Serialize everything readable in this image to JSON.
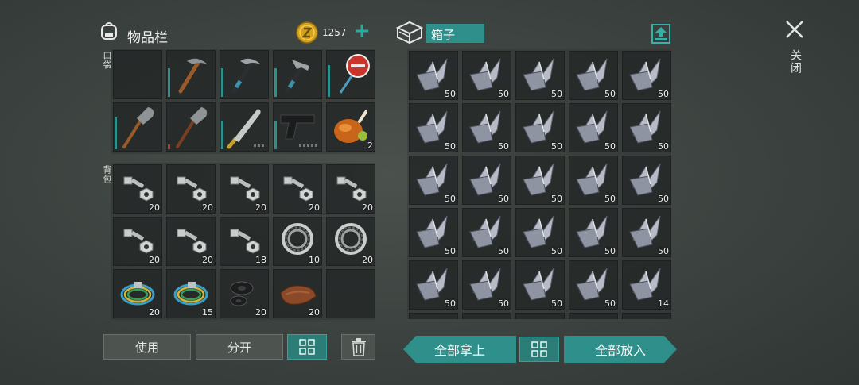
{
  "inventory": {
    "title": "物品栏",
    "coins": "1257",
    "add_label": "+",
    "pocket_label": "口袋",
    "backpack_label": "背包",
    "pocket_slots": [
      {
        "item": "empty",
        "qty": ""
      },
      {
        "item": "pickaxe-icon",
        "qty": ""
      },
      {
        "item": "pickaxe-icon",
        "qty": ""
      },
      {
        "item": "hammer-icon",
        "qty": ""
      },
      {
        "item": "stop-sign-icon",
        "qty": ""
      },
      {
        "item": "shovel-icon",
        "qty": ""
      },
      {
        "item": "shovel-icon",
        "qty": ""
      },
      {
        "item": "machete-icon",
        "qty": ""
      },
      {
        "item": "pistol-icon",
        "qty": ""
      },
      {
        "item": "roast-chicken-icon",
        "qty": "2"
      }
    ],
    "backpack_slots": [
      {
        "item": "bolt-nut-icon",
        "qty": "20"
      },
      {
        "item": "bolt-nut-icon",
        "qty": "20"
      },
      {
        "item": "bolt-nut-icon",
        "qty": "20"
      },
      {
        "item": "bolt-nut-icon",
        "qty": "20"
      },
      {
        "item": "bolt-nut-icon",
        "qty": "20"
      },
      {
        "item": "bolt-nut-icon",
        "qty": "20"
      },
      {
        "item": "bolt-nut-icon",
        "qty": "20"
      },
      {
        "item": "bolt-nut-icon",
        "qty": "18"
      },
      {
        "item": "bearing-icon",
        "qty": "10"
      },
      {
        "item": "bearing-icon",
        "qty": "20"
      },
      {
        "item": "wire-coil-icon",
        "qty": "20"
      },
      {
        "item": "wire-coil-icon",
        "qty": "15"
      },
      {
        "item": "rubber-washer-icon",
        "qty": "20"
      },
      {
        "item": "leather-icon",
        "qty": "20"
      },
      {
        "item": "empty",
        "qty": ""
      }
    ],
    "buttons": {
      "use": "使用",
      "split": "分开"
    }
  },
  "box": {
    "title": "箱子",
    "item_icon": "metal-scrap-icon",
    "slot_qtys": [
      "50",
      "50",
      "50",
      "50",
      "50",
      "50",
      "50",
      "50",
      "50",
      "50",
      "50",
      "50",
      "50",
      "50",
      "50",
      "50",
      "50",
      "50",
      "50",
      "50",
      "50",
      "50",
      "50",
      "50",
      "14"
    ],
    "buttons": {
      "take_all": "全部拿上",
      "put_all": "全部放入"
    }
  },
  "close_label": "关闭",
  "colors": {
    "accent": "#2f8f8a",
    "accent_light": "#3aa19a",
    "slot_bg": "#232727",
    "coin": "#d7a21a"
  }
}
